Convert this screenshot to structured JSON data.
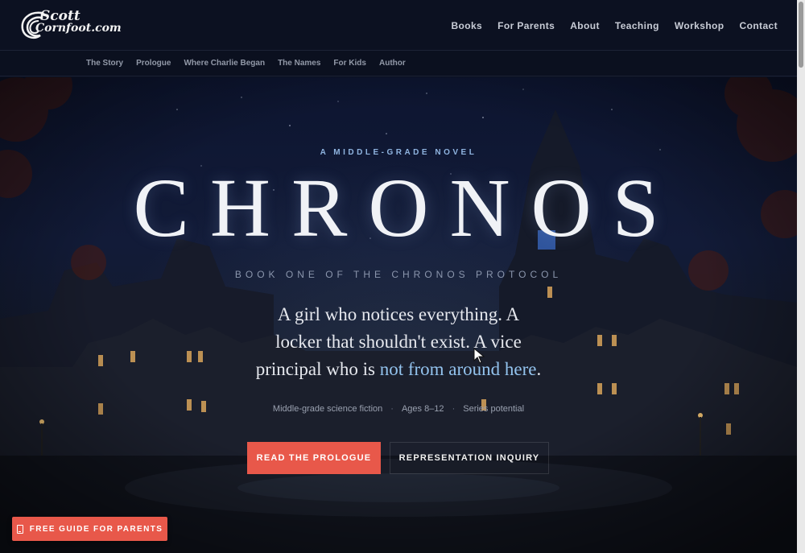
{
  "header": {
    "logo": {
      "line1": "Scott",
      "line2": "Cornfoot.com"
    },
    "nav": [
      "Books",
      "For Parents",
      "About",
      "Teaching",
      "Workshop",
      "Contact"
    ]
  },
  "subnav": [
    "The Story",
    "Prologue",
    "Where Charlie Began",
    "The Names",
    "For Kids",
    "Author"
  ],
  "hero": {
    "eyebrow": "A MIDDLE-GRADE NOVEL",
    "title": "CHRONOS",
    "subtitle": "BOOK ONE OF THE CHRONOS PROTOCOL",
    "tagline_main": "A girl who notices everything. A locker that shouldn't exist. A vice principal who is ",
    "tagline_highlight": "not from around here",
    "tagline_end": ".",
    "meta": [
      "Middle-grade science fiction",
      "Ages 8–12",
      "Series potential"
    ],
    "meta_separator": "·",
    "primary_cta": "READ THE PROLOGUE",
    "secondary_cta": "REPRESENTATION INQUIRY"
  },
  "floating_cta": {
    "label": "FREE GUIDE FOR PARENTS",
    "icon": "tablet-icon"
  },
  "colors": {
    "accent": "#e8584a",
    "highlight": "#93c3ee",
    "background": "#0b1020"
  }
}
